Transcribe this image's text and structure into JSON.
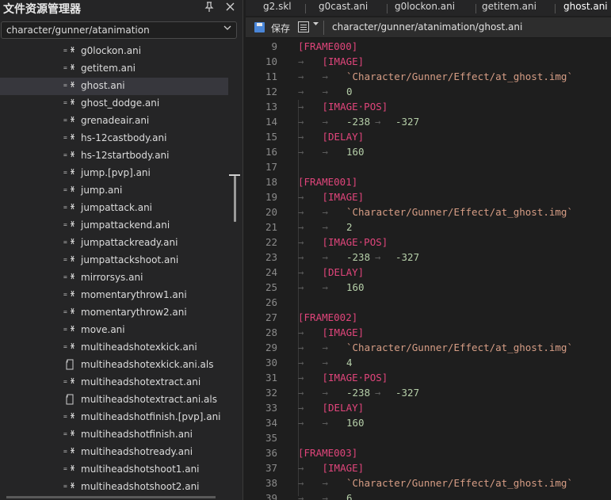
{
  "left_panel": {
    "title": "文件资源管理器",
    "pin_icon": "pin-icon",
    "close_icon": "close-icon",
    "path_select": {
      "value": "character/gunner/atanimation",
      "chevron": "chevron-down-icon"
    },
    "selected_index": 2,
    "files": [
      {
        "name": "g0lockon.ani",
        "icon": "ani-file-icon"
      },
      {
        "name": "getitem.ani",
        "icon": "ani-file-icon"
      },
      {
        "name": "ghost.ani",
        "icon": "ani-file-icon"
      },
      {
        "name": "ghost_dodge.ani",
        "icon": "ani-file-icon"
      },
      {
        "name": "grenadeair.ani",
        "icon": "ani-file-icon"
      },
      {
        "name": "hs-12castbody.ani",
        "icon": "ani-file-icon"
      },
      {
        "name": "hs-12startbody.ani",
        "icon": "ani-file-icon"
      },
      {
        "name": "jump.[pvp].ani",
        "icon": "ani-file-icon"
      },
      {
        "name": "jump.ani",
        "icon": "ani-file-icon"
      },
      {
        "name": "jumpattack.ani",
        "icon": "ani-file-icon"
      },
      {
        "name": "jumpattackend.ani",
        "icon": "ani-file-icon"
      },
      {
        "name": "jumpattackready.ani",
        "icon": "ani-file-icon"
      },
      {
        "name": "jumpattackshoot.ani",
        "icon": "ani-file-icon"
      },
      {
        "name": "mirrorsys.ani",
        "icon": "ani-file-icon"
      },
      {
        "name": "momentarythrow1.ani",
        "icon": "ani-file-icon"
      },
      {
        "name": "momentarythrow2.ani",
        "icon": "ani-file-icon"
      },
      {
        "name": "move.ani",
        "icon": "ani-file-icon"
      },
      {
        "name": "multiheadshotexkick.ani",
        "icon": "ani-file-icon"
      },
      {
        "name": "multiheadshotexkick.ani.als",
        "icon": "als-file-icon"
      },
      {
        "name": "multiheadshotextract.ani",
        "icon": "ani-file-icon"
      },
      {
        "name": "multiheadshotextract.ani.als",
        "icon": "als-file-icon"
      },
      {
        "name": "multiheadshotfinish.[pvp].ani",
        "icon": "ani-file-icon"
      },
      {
        "name": "multiheadshotfinish.ani",
        "icon": "ani-file-icon"
      },
      {
        "name": "multiheadshotready.ani",
        "icon": "ani-file-icon"
      },
      {
        "name": "multiheadshotshoot1.ani",
        "icon": "ani-file-icon"
      },
      {
        "name": "multiheadshotshoot2.ani",
        "icon": "ani-file-icon"
      }
    ]
  },
  "editor": {
    "tabs": [
      {
        "label": "g2.skl",
        "active": false
      },
      {
        "label": "g0cast.ani",
        "active": false
      },
      {
        "label": "g0lockon.ani",
        "active": false
      },
      {
        "label": "getitem.ani",
        "active": false
      },
      {
        "label": "ghost.ani",
        "active": true
      }
    ],
    "toolbar": {
      "save_icon": "save-icon",
      "save_label": "保存",
      "format_icon": "format-icon",
      "file_path": "character/gunner/atanimation/ghost.ani"
    },
    "arrow_glyph": "→",
    "lines": [
      {
        "n": "9",
        "indent": 0,
        "text": "[FRAME000]",
        "kind": "tag"
      },
      {
        "n": "10",
        "indent": 1,
        "text": "[IMAGE]",
        "kind": "tag"
      },
      {
        "n": "11",
        "indent": 2,
        "text": "`Character/Gunner/Effect/at_ghost.img`",
        "kind": "str"
      },
      {
        "n": "12",
        "indent": 2,
        "text": "0",
        "kind": "num"
      },
      {
        "n": "13",
        "indent": 1,
        "text": "[IMAGE·POS]",
        "kind": "tag"
      },
      {
        "n": "14",
        "indent": 2,
        "text": "-238",
        "kind": "num",
        "text2": "-327"
      },
      {
        "n": "15",
        "indent": 1,
        "text": "[DELAY]",
        "kind": "tag"
      },
      {
        "n": "16",
        "indent": 2,
        "text": "160",
        "kind": "num"
      },
      {
        "n": "17",
        "indent": 0,
        "text": "",
        "kind": "blank"
      },
      {
        "n": "18",
        "indent": 0,
        "text": "[FRAME001]",
        "kind": "tag"
      },
      {
        "n": "19",
        "indent": 1,
        "text": "[IMAGE]",
        "kind": "tag"
      },
      {
        "n": "20",
        "indent": 2,
        "text": "`Character/Gunner/Effect/at_ghost.img`",
        "kind": "str"
      },
      {
        "n": "21",
        "indent": 2,
        "text": "2",
        "kind": "num"
      },
      {
        "n": "22",
        "indent": 1,
        "text": "[IMAGE·POS]",
        "kind": "tag"
      },
      {
        "n": "23",
        "indent": 2,
        "text": "-238",
        "kind": "num",
        "text2": "-327"
      },
      {
        "n": "24",
        "indent": 1,
        "text": "[DELAY]",
        "kind": "tag"
      },
      {
        "n": "25",
        "indent": 2,
        "text": "160",
        "kind": "num"
      },
      {
        "n": "26",
        "indent": 0,
        "text": "",
        "kind": "blank"
      },
      {
        "n": "27",
        "indent": 0,
        "text": "[FRAME002]",
        "kind": "tag"
      },
      {
        "n": "28",
        "indent": 1,
        "text": "[IMAGE]",
        "kind": "tag"
      },
      {
        "n": "29",
        "indent": 2,
        "text": "`Character/Gunner/Effect/at_ghost.img`",
        "kind": "str"
      },
      {
        "n": "30",
        "indent": 2,
        "text": "4",
        "kind": "num"
      },
      {
        "n": "31",
        "indent": 1,
        "text": "[IMAGE·POS]",
        "kind": "tag"
      },
      {
        "n": "32",
        "indent": 2,
        "text": "-238",
        "kind": "num",
        "text2": "-327"
      },
      {
        "n": "33",
        "indent": 1,
        "text": "[DELAY]",
        "kind": "tag"
      },
      {
        "n": "34",
        "indent": 2,
        "text": "160",
        "kind": "num"
      },
      {
        "n": "35",
        "indent": 0,
        "text": "",
        "kind": "blank"
      },
      {
        "n": "36",
        "indent": 0,
        "text": "[FRAME003]",
        "kind": "tag"
      },
      {
        "n": "37",
        "indent": 1,
        "text": "[IMAGE]",
        "kind": "tag"
      },
      {
        "n": "38",
        "indent": 2,
        "text": "`Character/Gunner/Effect/at_ghost.img`",
        "kind": "str"
      },
      {
        "n": "39",
        "indent": 2,
        "text": "6",
        "kind": "num"
      }
    ]
  },
  "colors": {
    "tag": "#e0457b",
    "string": "#d69d85",
    "number": "#b5cea8",
    "line_number": "#8a8a8a",
    "selection": "#37373d",
    "accent": "#4a86d8"
  }
}
